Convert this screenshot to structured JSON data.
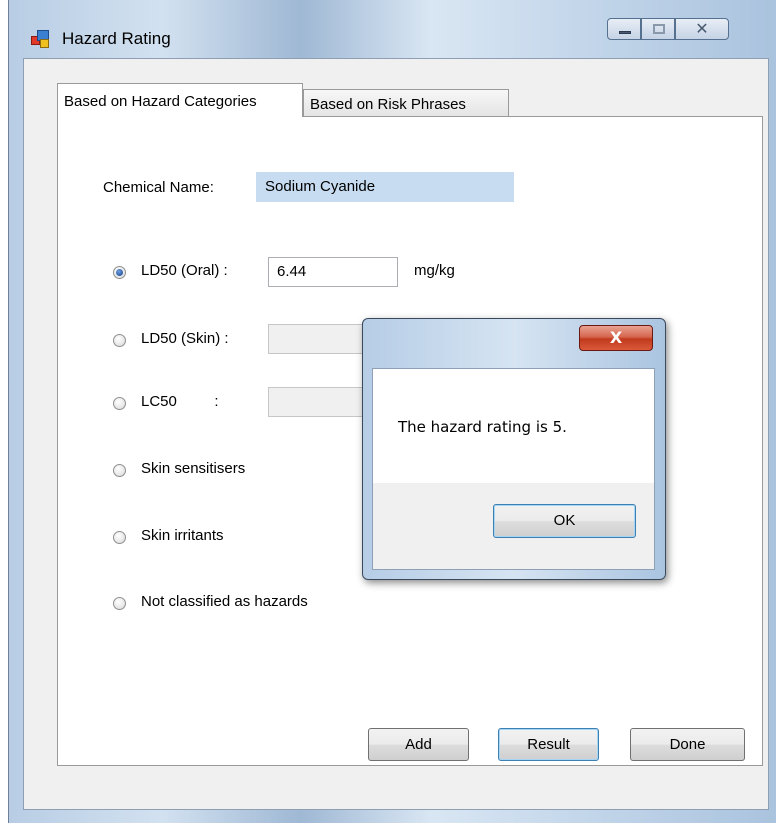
{
  "window": {
    "title": "Hazard Rating"
  },
  "tabs": [
    {
      "label": "Based on Hazard Categories",
      "active": true
    },
    {
      "label": "Based on Risk Phrases",
      "active": false
    }
  ],
  "form": {
    "chemical_name_label": "Chemical Name:",
    "chemical_name_value": "Sodium Cyanide",
    "options": [
      {
        "label": "LD50 (Oral) :",
        "value": "6.44",
        "unit": "mg/kg",
        "checked": true
      },
      {
        "label": "LD50 (Skin) :",
        "value": "",
        "checked": false
      },
      {
        "label": "LC50         :",
        "value": "",
        "checked": false
      },
      {
        "label": "Skin sensitisers",
        "checked": false
      },
      {
        "label": "Skin irritants",
        "checked": false
      },
      {
        "label": "Not classified as hazards",
        "checked": false
      }
    ],
    "buttons": {
      "add": "Add",
      "result": "Result",
      "done": "Done"
    }
  },
  "dialog": {
    "close_glyph": "X",
    "message": "The hazard rating is 5.",
    "ok_label": "OK"
  },
  "icons": {
    "close": "✕",
    "minimize": "minimize-icon",
    "maximize": "maximize-icon"
  },
  "colors": {
    "selection": "#c7dcf0",
    "close_red": "#c23a1e"
  }
}
